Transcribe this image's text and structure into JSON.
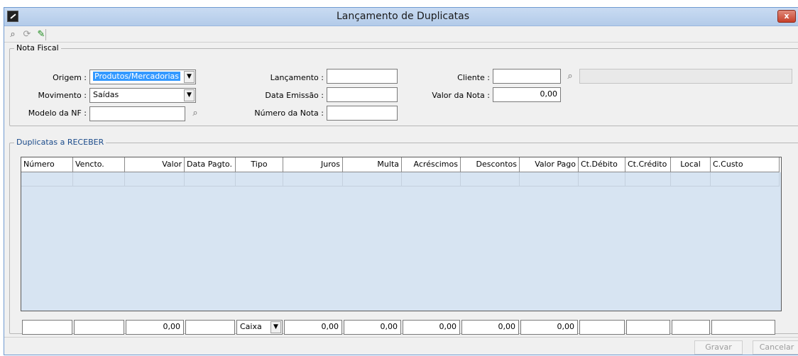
{
  "window": {
    "title": "Lançamento de Duplicatas",
    "close_label": "x"
  },
  "toolbar": {
    "icons": [
      "lookup-icon",
      "refresh-icon",
      "edit-icon"
    ]
  },
  "nota_fiscal": {
    "group_title": "Nota Fiscal",
    "origem_label": "Origem :",
    "origem_value": "Produtos/Mercadorias",
    "movimento_label": "Movimento :",
    "movimento_value": "Saídas",
    "modelo_label": "Modelo da NF :",
    "modelo_value": "",
    "lancamento_label": "Lançamento :",
    "lancamento_value": "",
    "data_emissao_label": "Data Emissão :",
    "data_emissao_value": "",
    "numero_nota_label": "Número da Nota :",
    "numero_nota_value": "",
    "cliente_label": "Cliente :",
    "cliente_value": "",
    "cliente_name": "",
    "valor_nota_label": "Valor da Nota :",
    "valor_nota_value": "0,00"
  },
  "duplicatas": {
    "group_title": "Duplicatas a RECEBER",
    "columns": [
      "Número",
      "Vencto.",
      "Valor",
      "Data Pagto.",
      "Tipo",
      "Juros",
      "Multa",
      "Acréscimos",
      "Descontos",
      "Valor Pago",
      "Ct.Débito",
      "Ct.Crédito",
      "Local",
      "C.Custo"
    ]
  },
  "footer": {
    "numero": "",
    "vencto": "",
    "valor": "0,00",
    "data_pagto": "",
    "tipo": "Caixa",
    "juros": "0,00",
    "multa": "0,00",
    "acrescimos": "0,00",
    "descontos": "0,00",
    "valor_pago": "0,00",
    "ct_debito": "",
    "ct_credito": "",
    "local": "",
    "c_custo": ""
  },
  "actions": {
    "gravar": "Gravar",
    "cancelar": "Cancelar"
  }
}
